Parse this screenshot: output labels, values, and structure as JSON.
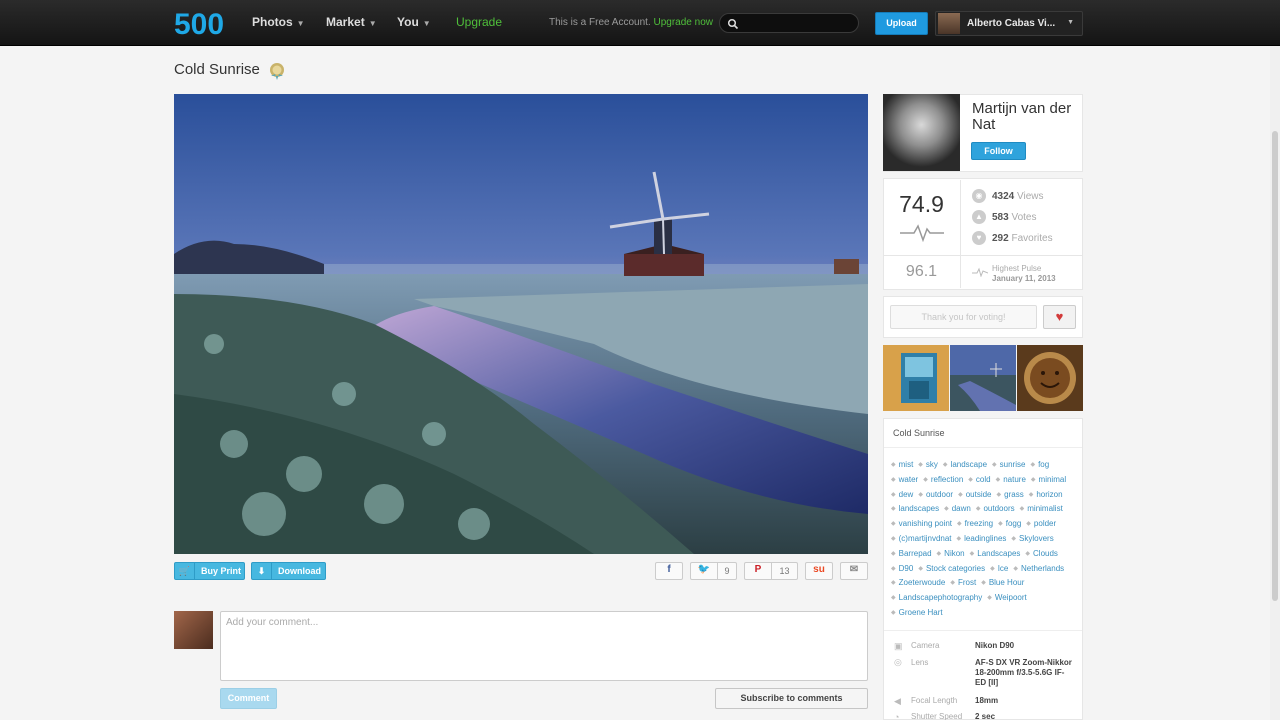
{
  "header": {
    "logo": "500",
    "nav": [
      {
        "label": "Photos",
        "caret": true
      },
      {
        "label": "Market",
        "caret": true
      },
      {
        "label": "You",
        "caret": true
      },
      {
        "label": "Upgrade",
        "caret": false
      }
    ],
    "free_account_text": "This is a Free Account.",
    "free_account_link": "Upgrade now",
    "search_placeholder": "",
    "upload_label": "Upload",
    "user_name": "Alberto Cabas Vi..."
  },
  "photo": {
    "title": "Cold Sunrise",
    "buy_print_label": "Buy Print",
    "download_label": "Download"
  },
  "share": {
    "twitter_count": "9",
    "pinterest_count": "13"
  },
  "comments": {
    "placeholder": "Add your comment...",
    "comment_button": "Comment",
    "subscribe_button": "Subscribe to comments"
  },
  "author": {
    "name": "Martijn van der Nat",
    "follow_label": "Follow"
  },
  "stats": {
    "pulse": "74.9",
    "highest_pulse": "96.1",
    "highest_pulse_label": "Highest Pulse",
    "highest_pulse_date": "January 11, 2013",
    "views": "4324",
    "views_label": "Views",
    "votes": "583",
    "votes_label": "Votes",
    "favorites": "292",
    "favorites_label": "Favorites"
  },
  "vote": {
    "thanks_label": "Thank you for voting!"
  },
  "tags": [
    "mist",
    "sky",
    "landscape",
    "sunrise",
    "fog",
    "water",
    "reflection",
    "cold",
    "nature",
    "minimal",
    "dew",
    "outdoor",
    "outside",
    "grass",
    "horizon",
    "landscapes",
    "dawn",
    "outdoors",
    "minimalist",
    "vanishing point",
    "freezing",
    "fogg",
    "polder",
    "(c)martijnvdnat",
    "leadinglines",
    "Skylovers",
    "Barrepad",
    "Nikon",
    "Landscapes",
    "Clouds",
    "D90",
    "Stock categories",
    "Ice",
    "Netherlands",
    "Zoeterwoude",
    "Frost",
    "Blue Hour",
    "Landscapephotography",
    "Weipoort",
    "Groene Hart"
  ],
  "exif": {
    "camera_label": "Camera",
    "camera_value": "Nikon D90",
    "lens_label": "Lens",
    "lens_value": "AF-S DX VR Zoom-Nikkor 18-200mm f/3.5-5.6G IF-ED [II]",
    "focal_label": "Focal Length",
    "focal_value": "18mm",
    "shutter_label": "Shutter Speed",
    "shutter_value": "2 sec"
  },
  "colors": {
    "accent": "#1f9ae0",
    "upgrade_green": "#4fbf3a",
    "tag_link": "#3a8fbf"
  }
}
